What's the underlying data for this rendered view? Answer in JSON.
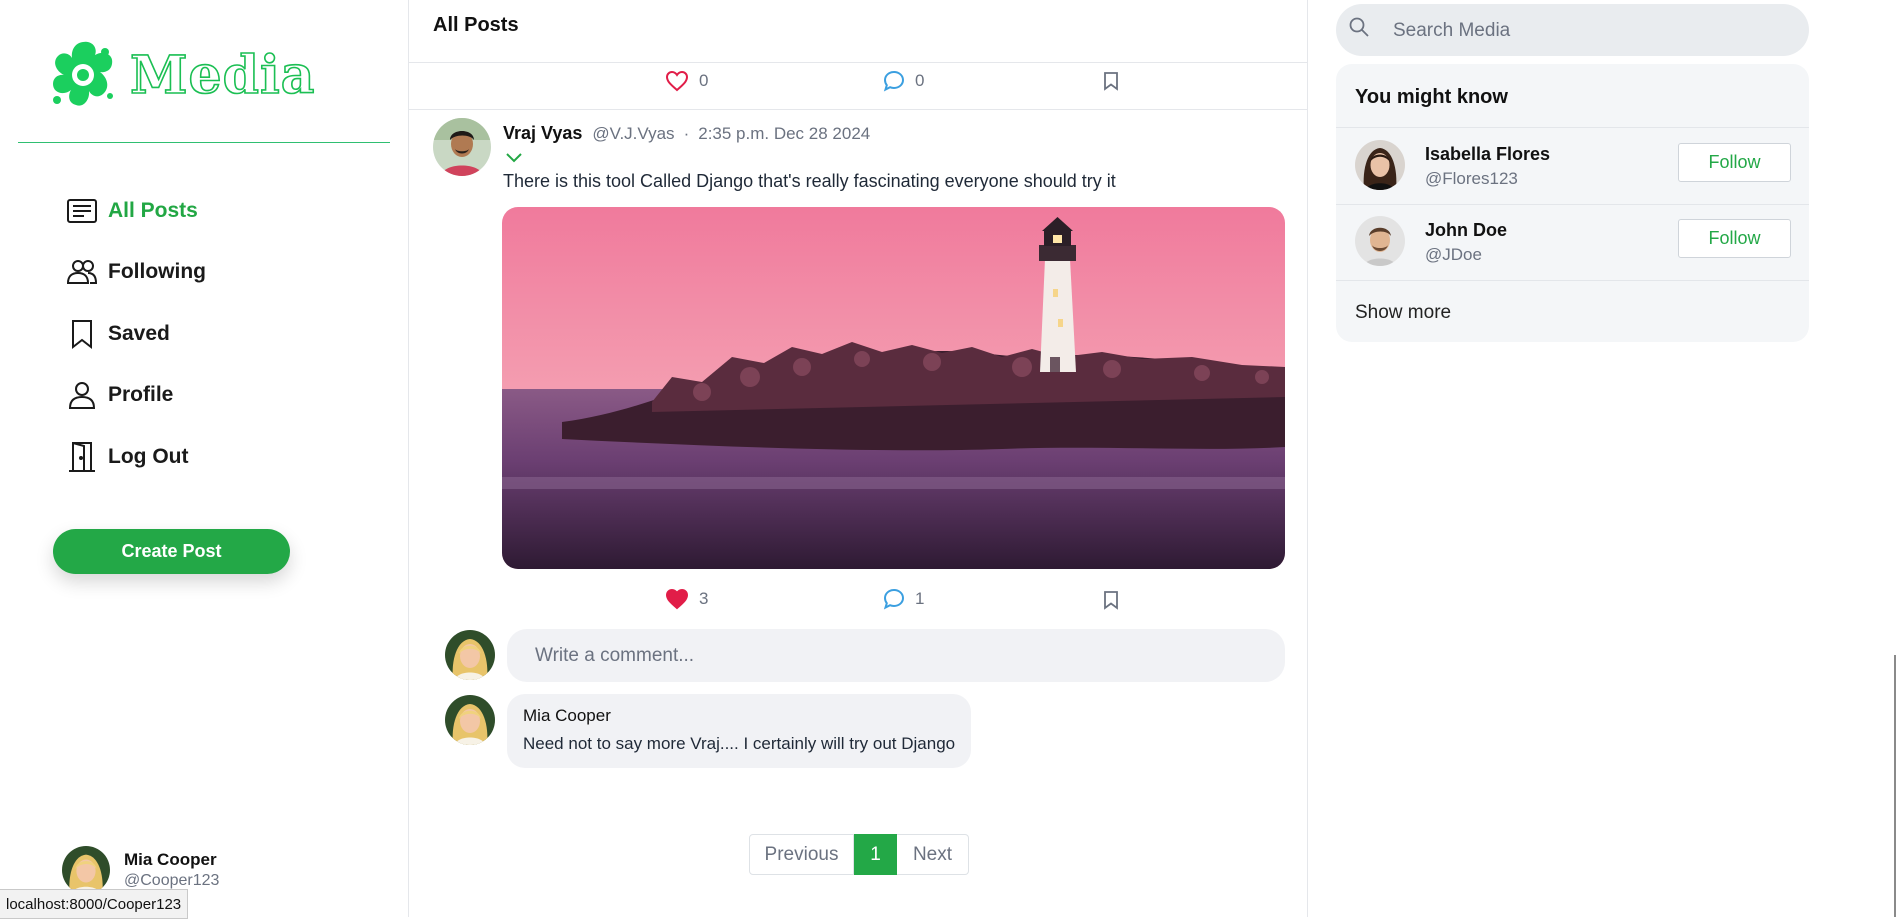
{
  "app": {
    "name": "Media",
    "brand_color": "#22c55e",
    "accent_color": "#23a847"
  },
  "sidebar": {
    "items": [
      {
        "label": "All Posts",
        "icon": "list-icon",
        "active": true
      },
      {
        "label": "Following",
        "icon": "users-icon",
        "active": false
      },
      {
        "label": "Saved",
        "icon": "bookmark-icon",
        "active": false
      },
      {
        "label": "Profile",
        "icon": "user-icon",
        "active": false
      },
      {
        "label": "Log Out",
        "icon": "door-icon",
        "active": false
      }
    ],
    "create_post_label": "Create Post",
    "current_user": {
      "name": "Mia Cooper",
      "handle": "@Cooper123"
    }
  },
  "status_bar": {
    "url": "localhost:8000/Cooper123"
  },
  "main": {
    "title": "All Posts",
    "prev_post_actions": {
      "likes": "0",
      "comments": "0"
    },
    "post": {
      "author": "Vraj Vyas",
      "handle": "@V.J.Vyas",
      "separator": "·",
      "timestamp": "2:35 p.m. Dec 28 2024",
      "text": "There is this tool Called Django that's really fascinating everyone should try it",
      "image_subject": "lighthouse-at-sunset",
      "likes": "3",
      "comments": "1",
      "liked": true,
      "like_color": "#e11d48",
      "comment_icon_color": "#3b9fe0"
    },
    "comment_placeholder": "Write a comment...",
    "comments": [
      {
        "author": "Mia Cooper",
        "text": "Need not to say more Vraj.... I certainly will try out Django"
      }
    ],
    "pagination": {
      "previous": "Previous",
      "current": "1",
      "next": "Next"
    }
  },
  "right": {
    "search_placeholder": "Search Media",
    "you_might_know_title": "You might know",
    "suggestions": [
      {
        "name": "Isabella Flores",
        "handle": "@Flores123",
        "button": "Follow"
      },
      {
        "name": "John Doe",
        "handle": "@JDoe",
        "button": "Follow"
      }
    ],
    "show_more": "Show more"
  }
}
